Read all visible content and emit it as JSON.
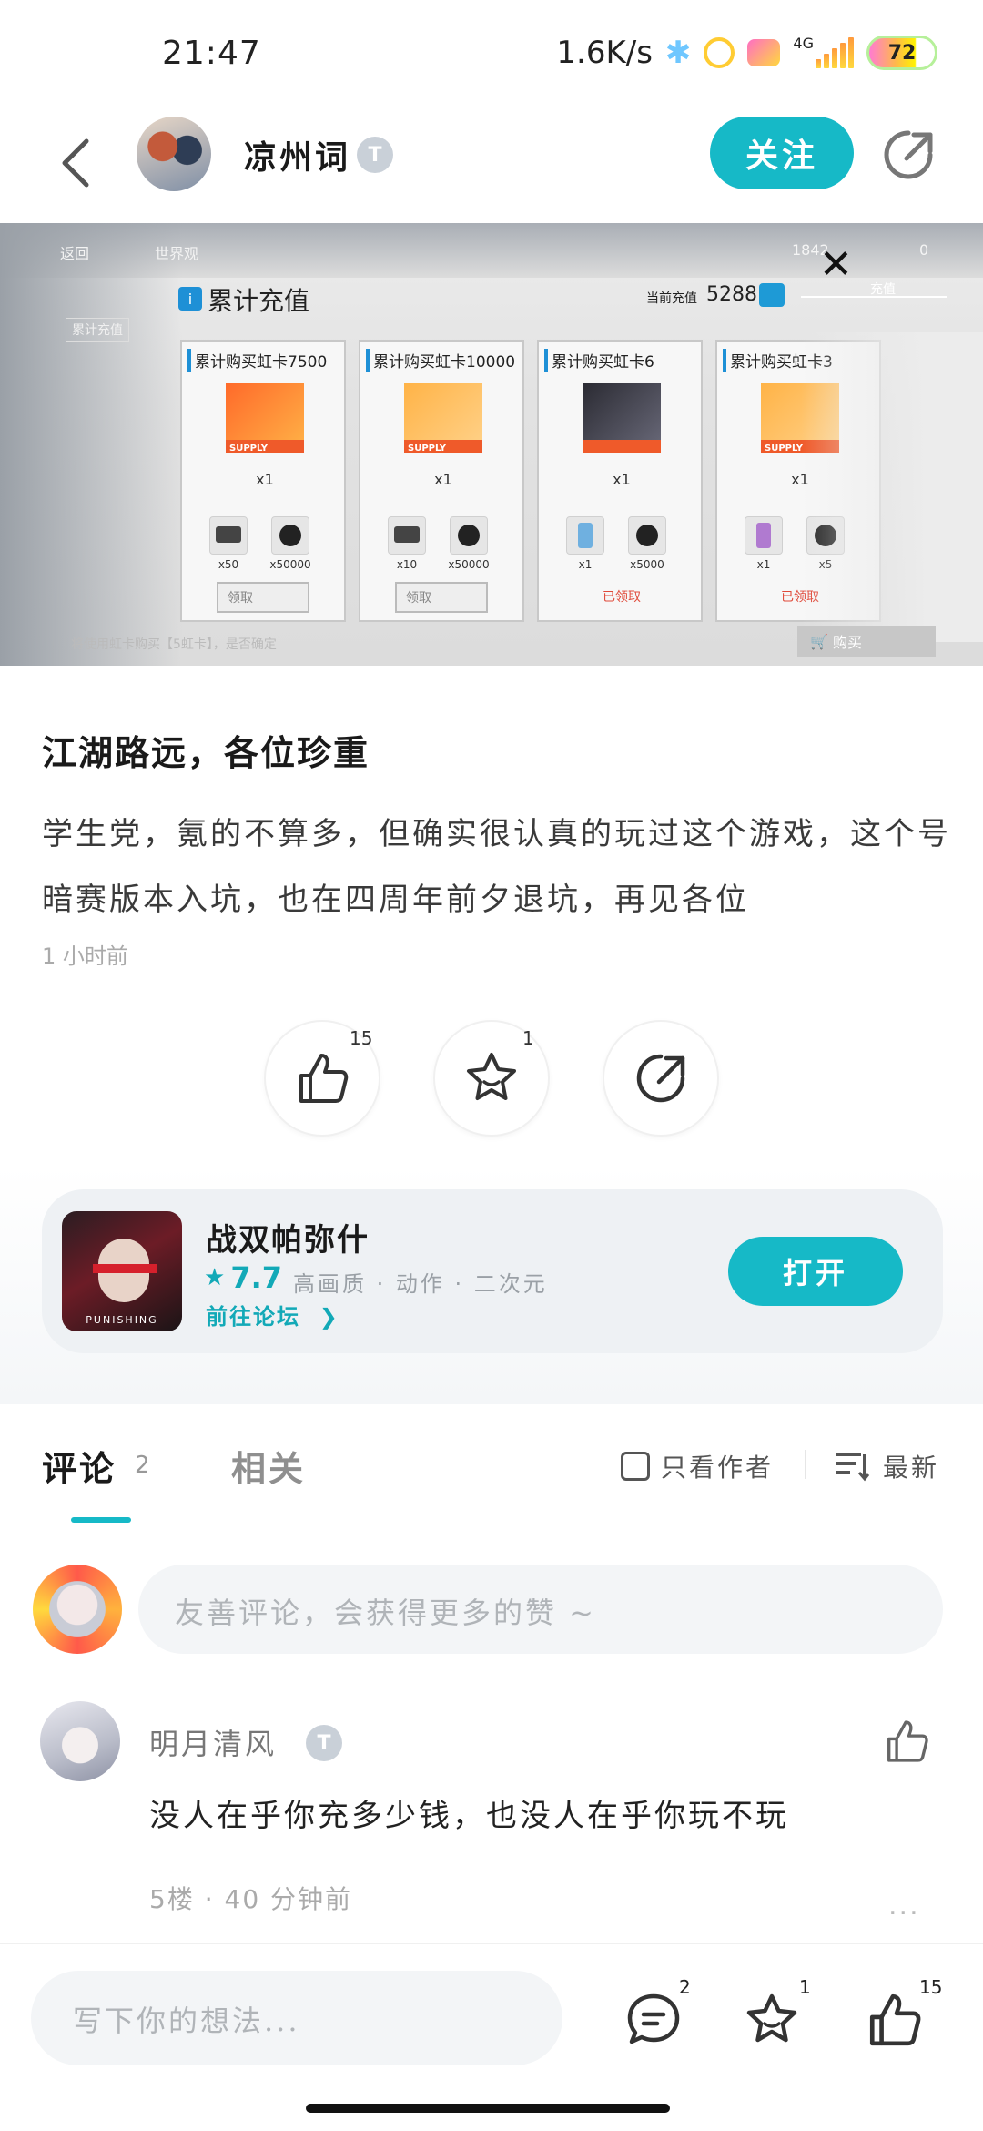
{
  "status_bar": {
    "time": "21:47",
    "net_speed": "1.6K/s",
    "network": "4G",
    "battery": "72"
  },
  "header": {
    "author_name": "凉州词",
    "author_level": "T",
    "follow_label": "关注"
  },
  "screenshot": {
    "nav_back": "返回",
    "nav_world": "世界观",
    "resource_1": "1842",
    "resource_2": "0",
    "side_tab": "累计充值",
    "tab_right": "充值",
    "panel_title": "累计充值",
    "recharge_label": "当前充值",
    "recharge_value": "5288",
    "supply_label": "SUPPLY",
    "cards": [
      {
        "title": "累计购买虹卡7500",
        "qty": "x1",
        "items": [
          "x50",
          "x50000"
        ],
        "action": "领取",
        "claimed": false
      },
      {
        "title": "累计购买虹卡10000",
        "qty": "x1",
        "items": [
          "x10",
          "x50000"
        ],
        "action": "领取",
        "claimed": false
      },
      {
        "title": "累计购买虹卡6",
        "qty": "x1",
        "items": [
          "x1",
          "x5000"
        ],
        "action": "已领取",
        "claimed": true
      },
      {
        "title": "累计购买虹卡3",
        "qty": "x1",
        "items": [
          "x1",
          "x5"
        ],
        "action": "已领取",
        "claimed": true
      }
    ],
    "bottom_text": "将使用虹卡购买【5虹卡】，是否确定",
    "buy_label": "购买"
  },
  "post": {
    "title": "江湖路远，各位珍重",
    "body": "学生党，氪的不算多，但确实很认真的玩过这个游戏，这个号暗赛版本入坑，也在四周年前夕退坑，再见各位",
    "time": "1 小时前",
    "like_count": "15",
    "favorite_count": "1"
  },
  "game": {
    "name": "战双帕弥什",
    "rating": "7.7",
    "tags": "高画质 · 动作 · 二次元",
    "forum_link": "前往论坛",
    "open_label": "打开",
    "icon_label": "PUNISHING"
  },
  "comments": {
    "tab_label": "评论",
    "count": "2",
    "related_label": "相关",
    "author_only_label": "只看作者",
    "sort_label": "最新",
    "input_placeholder": "友善评论，会获得更多的赞 ~",
    "items": [
      {
        "user": "明月清风",
        "level": "T",
        "text": "没人在乎你充多少钱，也没人在乎你玩不玩",
        "meta": "5楼 · 40 分钟前",
        "more": "..."
      }
    ]
  },
  "bottom_bar": {
    "placeholder": "写下你的想法...",
    "comment_count": "2",
    "favorite_count": "1",
    "like_count": "15"
  },
  "colors": {
    "accent": "#16b9c7",
    "text_primary": "#1a1a1a",
    "text_secondary": "#aaaaaa"
  }
}
